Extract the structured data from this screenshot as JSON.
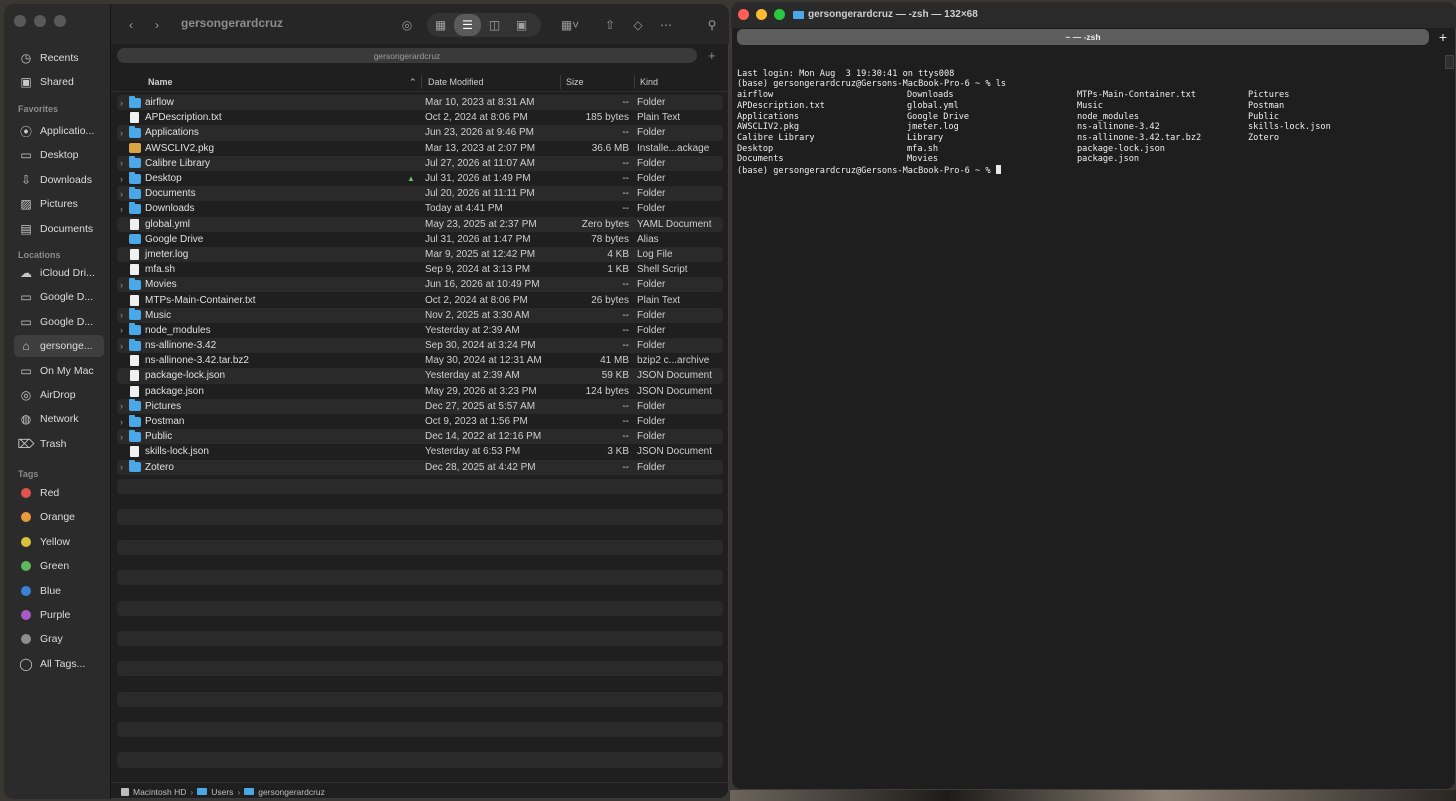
{
  "finder": {
    "title": "gersongerardcruz",
    "path_tab": "gersongerardcruz",
    "sidebar": {
      "favorites_heading": "Favorites",
      "locations_heading": "Locations",
      "tags_heading": "Tags",
      "top_items": [
        {
          "label": "Recents",
          "icon": "clock-icon"
        },
        {
          "label": "Shared",
          "icon": "shared-folder-icon"
        }
      ],
      "favorites": [
        {
          "label": "Applicatio...",
          "icon": "applications-icon"
        },
        {
          "label": "Desktop",
          "icon": "desktop-icon"
        },
        {
          "label": "Downloads",
          "icon": "download-icon"
        },
        {
          "label": "Pictures",
          "icon": "pictures-icon"
        },
        {
          "label": "Documents",
          "icon": "document-icon"
        }
      ],
      "locations": [
        {
          "label": "iCloud Dri...",
          "icon": "cloud-icon"
        },
        {
          "label": "Google D...",
          "icon": "drive-icon"
        },
        {
          "label": "Google D...",
          "icon": "drive-icon"
        },
        {
          "label": "gersonge...",
          "icon": "home-icon"
        },
        {
          "label": "On My Mac",
          "icon": "folder-icon"
        },
        {
          "label": "AirDrop",
          "icon": "airdrop-icon"
        },
        {
          "label": "Network",
          "icon": "network-icon"
        },
        {
          "label": "Trash",
          "icon": "trash-icon"
        }
      ],
      "tags": [
        {
          "label": "Red",
          "color": "#e0534e"
        },
        {
          "label": "Orange",
          "color": "#e89a3c"
        },
        {
          "label": "Yellow",
          "color": "#d9c23a"
        },
        {
          "label": "Green",
          "color": "#5fb85b"
        },
        {
          "label": "Blue",
          "color": "#3b82d6"
        },
        {
          "label": "Purple",
          "color": "#a65bc7"
        },
        {
          "label": "Gray",
          "color": "#8e8e8e"
        },
        {
          "label": "All Tags...",
          "color": ""
        }
      ]
    },
    "columns": {
      "name": "Name",
      "date": "Date Modified",
      "size": "Size",
      "kind": "Kind"
    },
    "files": [
      {
        "name": "airflow",
        "date": "Mar 10, 2023 at 8:31 AM",
        "size": "--",
        "kind": "Folder",
        "type": "folder"
      },
      {
        "name": "APDescription.txt",
        "date": "Oct 2, 2024 at 8:06 PM",
        "size": "185 bytes",
        "kind": "Plain Text",
        "type": "doc"
      },
      {
        "name": "Applications",
        "date": "Jun 23, 2026 at 9:46 PM",
        "size": "--",
        "kind": "Folder",
        "type": "folder"
      },
      {
        "name": "AWSCLIV2.pkg",
        "date": "Mar 13, 2023 at 2:07 PM",
        "size": "36.6 MB",
        "kind": "Installe...ackage",
        "type": "pkg"
      },
      {
        "name": "Calibre Library",
        "date": "Jul 27, 2026 at 11:07 AM",
        "size": "--",
        "kind": "Folder",
        "type": "folder"
      },
      {
        "name": "Desktop",
        "date": "Jul 31, 2026 at 1:49 PM",
        "size": "--",
        "kind": "Folder",
        "type": "folder",
        "badge": "google-drive-badge-icon"
      },
      {
        "name": "Documents",
        "date": "Jul 20, 2026 at 11:11 PM",
        "size": "--",
        "kind": "Folder",
        "type": "folder"
      },
      {
        "name": "Downloads",
        "date": "Today at 4:41 PM",
        "size": "--",
        "kind": "Folder",
        "type": "folder"
      },
      {
        "name": "global.yml",
        "date": "May 23, 2025 at 2:37 PM",
        "size": "Zero bytes",
        "kind": "YAML Document",
        "type": "doc"
      },
      {
        "name": "Google Drive",
        "date": "Jul 31, 2026 at 1:47 PM",
        "size": "78 bytes",
        "kind": "Alias",
        "type": "alias"
      },
      {
        "name": "jmeter.log",
        "date": "Mar 9, 2025 at 12:42 PM",
        "size": "4 KB",
        "kind": "Log File",
        "type": "doc"
      },
      {
        "name": "mfa.sh",
        "date": "Sep 9, 2024 at 3:13 PM",
        "size": "1 KB",
        "kind": "Shell Script",
        "type": "doc"
      },
      {
        "name": "Movies",
        "date": "Jun 16, 2026 at 10:49 PM",
        "size": "--",
        "kind": "Folder",
        "type": "folder"
      },
      {
        "name": "MTPs-Main-Container.txt",
        "date": "Oct 2, 2024 at 8:06 PM",
        "size": "26 bytes",
        "kind": "Plain Text",
        "type": "doc"
      },
      {
        "name": "Music",
        "date": "Nov 2, 2025 at 3:30 AM",
        "size": "--",
        "kind": "Folder",
        "type": "folder"
      },
      {
        "name": "node_modules",
        "date": "Yesterday at 2:39 AM",
        "size": "--",
        "kind": "Folder",
        "type": "folder"
      },
      {
        "name": "ns-allinone-3.42",
        "date": "Sep 30, 2024 at 3:24 PM",
        "size": "--",
        "kind": "Folder",
        "type": "folder"
      },
      {
        "name": "ns-allinone-3.42.tar.bz2",
        "date": "May 30, 2024 at 12:31 AM",
        "size": "41 MB",
        "kind": "bzip2 c...archive",
        "type": "doc"
      },
      {
        "name": "package-lock.json",
        "date": "Yesterday at 2:39 AM",
        "size": "59 KB",
        "kind": "JSON Document",
        "type": "doc"
      },
      {
        "name": "package.json",
        "date": "May 29, 2026 at 3:23 PM",
        "size": "124 bytes",
        "kind": "JSON Document",
        "type": "doc"
      },
      {
        "name": "Pictures",
        "date": "Dec 27, 2025 at 5:57 AM",
        "size": "--",
        "kind": "Folder",
        "type": "folder"
      },
      {
        "name": "Postman",
        "date": "Oct 9, 2023 at 1:56 PM",
        "size": "--",
        "kind": "Folder",
        "type": "folder"
      },
      {
        "name": "Public",
        "date": "Dec 14, 2022 at 12:16 PM",
        "size": "--",
        "kind": "Folder",
        "type": "folder"
      },
      {
        "name": "skills-lock.json",
        "date": "Yesterday at 6:53 PM",
        "size": "3 KB",
        "kind": "JSON Document",
        "type": "doc"
      },
      {
        "name": "Zotero",
        "date": "Dec 28, 2025 at 4:42 PM",
        "size": "--",
        "kind": "Folder",
        "type": "folder"
      }
    ],
    "statusbar": [
      "Macintosh HD",
      "Users",
      "gersongerardcruz"
    ]
  },
  "terminal": {
    "title": "gersongerardcruz — -zsh — 132×68",
    "tab": "~ — -zsh",
    "last_login": "Last login: Mon Aug  3 19:30:41 on ttys008",
    "prompt1": "(base) gersongerardcruz@Gersons-MacBook-Pro-6 ~ % ls",
    "ls_columns": [
      [
        "airflow",
        "APDescription.txt",
        "Applications",
        "AWSCLIV2.pkg",
        "Calibre Library",
        "Desktop",
        "Documents"
      ],
      [
        "Downloads",
        "global.yml",
        "Google Drive",
        "jmeter.log",
        "Library",
        "mfa.sh",
        "Movies"
      ],
      [
        "MTPs-Main-Container.txt",
        "Music",
        "node_modules",
        "ns-allinone-3.42",
        "ns-allinone-3.42.tar.bz2",
        "package-lock.json",
        "package.json"
      ],
      [
        "Pictures",
        "Postman",
        "Public",
        "skills-lock.json",
        "Zotero"
      ]
    ],
    "prompt2": "(base) gersongerardcruz@Gersons-MacBook-Pro-6 ~ % "
  }
}
